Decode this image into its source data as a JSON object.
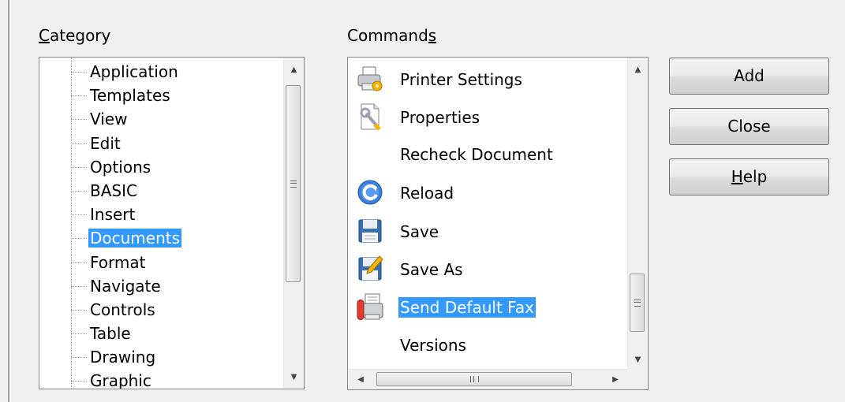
{
  "category": {
    "label_key": "C",
    "label_rest": "ategory",
    "items": [
      "Application",
      "Templates",
      "View",
      "Edit",
      "Options",
      "BASIC",
      "Insert",
      "Documents",
      "Format",
      "Navigate",
      "Controls",
      "Table",
      "Drawing",
      "Graphic"
    ],
    "selected_index": 7
  },
  "commands": {
    "label_pre": "Command",
    "label_key": "s",
    "items": [
      {
        "label": "Printer Settings",
        "icon": "printer-icon"
      },
      {
        "label": "Properties",
        "icon": "properties-icon"
      },
      {
        "label": "Recheck Document",
        "icon": ""
      },
      {
        "label": "Reload",
        "icon": "reload-icon"
      },
      {
        "label": "Save",
        "icon": "save-icon"
      },
      {
        "label": "Save As",
        "icon": "save-as-icon"
      },
      {
        "label": "Send Default Fax",
        "icon": "fax-icon"
      },
      {
        "label": "Versions",
        "icon": ""
      }
    ],
    "selected_index": 6
  },
  "buttons": {
    "add": "Add",
    "close": "Close",
    "help_key": "H",
    "help_rest": "elp"
  },
  "colors": {
    "selection": "#3399ff",
    "background": "#f0f0f0"
  }
}
